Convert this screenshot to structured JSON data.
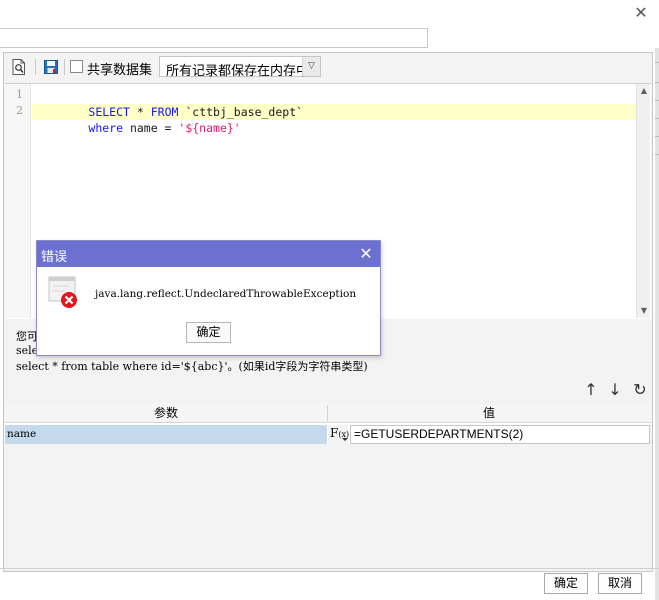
{
  "window": {
    "close_glyph": "✕"
  },
  "toolbar": {
    "preview_icon": "preview-icon",
    "save_icon": "save-icon",
    "shared_dataset_label": "共享数据集",
    "shared_dataset_checked": false,
    "memory_mode": {
      "selected": "所有记录都保存在内存中",
      "arrow": "▽"
    }
  },
  "editor": {
    "lines": [
      {
        "no": "1",
        "tokens": [
          {
            "t": "SELECT",
            "c": "kw"
          },
          {
            "t": " * ",
            "c": "pl"
          },
          {
            "t": "FROM",
            "c": "kw"
          },
          {
            "t": " `cttbj_base_dept`",
            "c": "pl"
          }
        ]
      },
      {
        "no": "2",
        "tokens": [
          {
            "t": "where",
            "c": "kw"
          },
          {
            "t": " name = ",
            "c": "pl"
          },
          {
            "t": "'${name}'",
            "c": "str"
          }
        ]
      }
    ],
    "scroll_up": "▲",
    "scroll_down": "▼"
  },
  "hints": {
    "line1": "您可",
    "line2": "sele",
    "line3": "select * from table where id='${abc}'。(如果id字段为字符串类型)"
  },
  "param_actions": {
    "up": "↑",
    "down": "↓",
    "refresh": "↻"
  },
  "params_table": {
    "headers": [
      "参数",
      "值"
    ],
    "rows": [
      {
        "name": "name",
        "value": "=GETUSERDEPARTMENTS(2)"
      }
    ],
    "fx_label": "F",
    "fx_sub": "(x)"
  },
  "footer": {
    "ok_label": "确定",
    "cancel_label": "取消"
  },
  "error_dialog": {
    "title": "错误",
    "close_glyph": "✕",
    "message": "java.lang.reflect.UndeclaredThrowableException",
    "ok_label": "确定",
    "icon": "error-icon",
    "title_color": "#6c70d1",
    "error_color": "#e3161b"
  }
}
